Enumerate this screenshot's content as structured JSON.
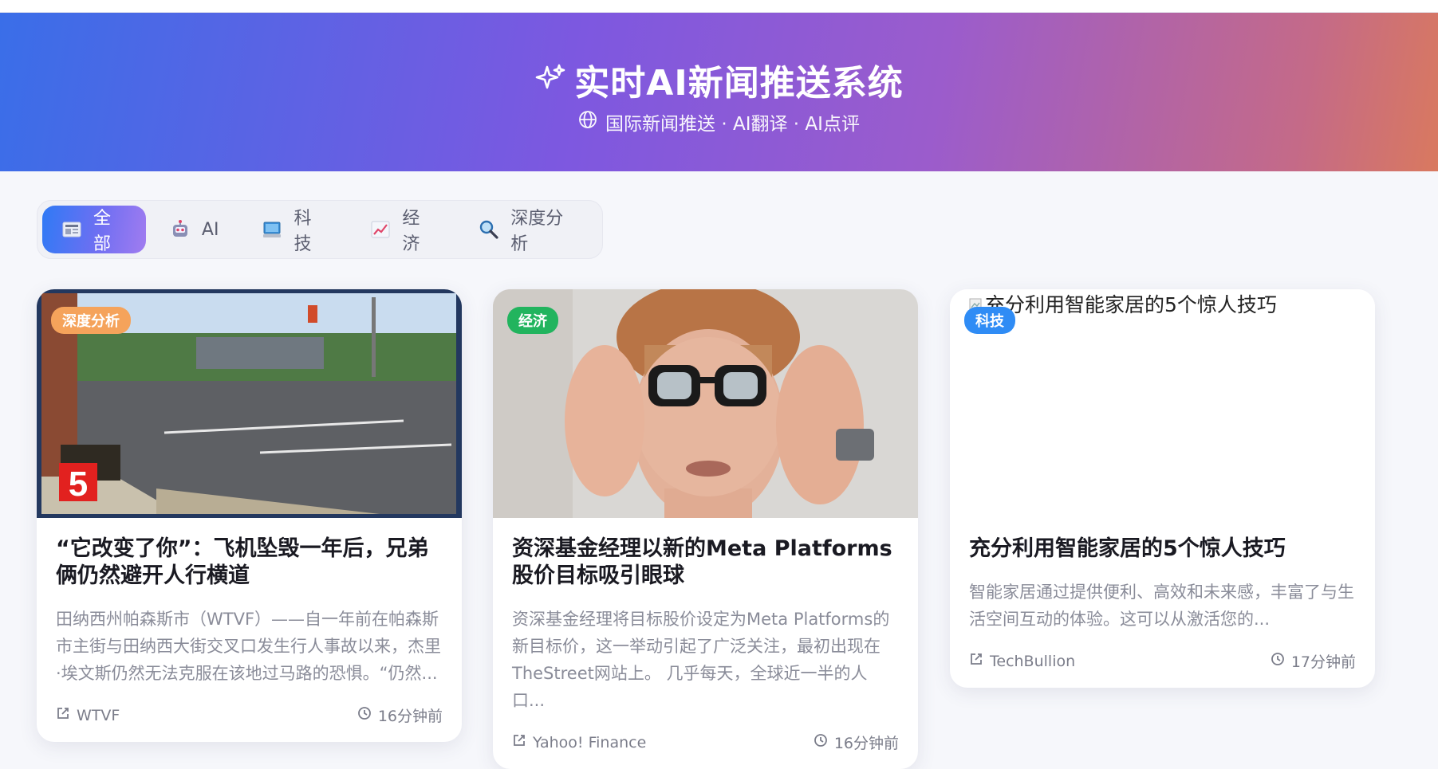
{
  "header": {
    "title": "实时AI新闻推送系统",
    "subtitle": "国际新闻推送 · AI翻译 · AI点评",
    "title_icon": "sparkles-icon",
    "subtitle_icon": "globe-icon"
  },
  "tabs": [
    {
      "label": "全部",
      "icon": "newspaper-icon",
      "active": true
    },
    {
      "label": "AI",
      "icon": "robot-icon",
      "active": false
    },
    {
      "label": "科技",
      "icon": "computer-icon",
      "active": false
    },
    {
      "label": "经济",
      "icon": "chart-icon",
      "active": false
    },
    {
      "label": "深度分析",
      "icon": "magnifier-icon",
      "active": false
    }
  ],
  "cards": [
    {
      "badge": "深度分析",
      "badge_color": "#f5a35b",
      "title": "“它改变了你”：飞机坠毁一年后，兄弟俩仍然避开人行横道",
      "summary": "田纳西州帕森斯市（WTVF）——自一年前在帕森斯市主街与田纳西大街交叉口发生行人事故以来，杰里·埃文斯仍然无法克服在该地过马路的恐惧。“仍然...",
      "source": "WTVF",
      "time": "16分钟前",
      "image": "street intersection photo"
    },
    {
      "badge": "经济",
      "badge_color": "#22b45e",
      "title": "资深基金经理以新的Meta Platforms股价目标吸引眼球",
      "summary": "资深基金经理将目标股价设定为Meta Platforms的新目标价，这一举动引起了广泛关注，最初出现在TheStreet网站上。 几乎每天，全球近一半的人口...",
      "source": "Yahoo! Finance",
      "time": "16分钟前",
      "image": "man wearing glasses photo"
    },
    {
      "badge": "科技",
      "badge_color": "#2f8cf5",
      "image_alt": "充分利用智能家居的5个惊人技巧",
      "title": "充分利用智能家居的5个惊人技巧",
      "summary": "智能家居通过提供便利、高效和未来感，丰富了与生活空间互动的体验。这可以从激活您的...",
      "source": "TechBullion",
      "time": "17分钟前"
    }
  ]
}
